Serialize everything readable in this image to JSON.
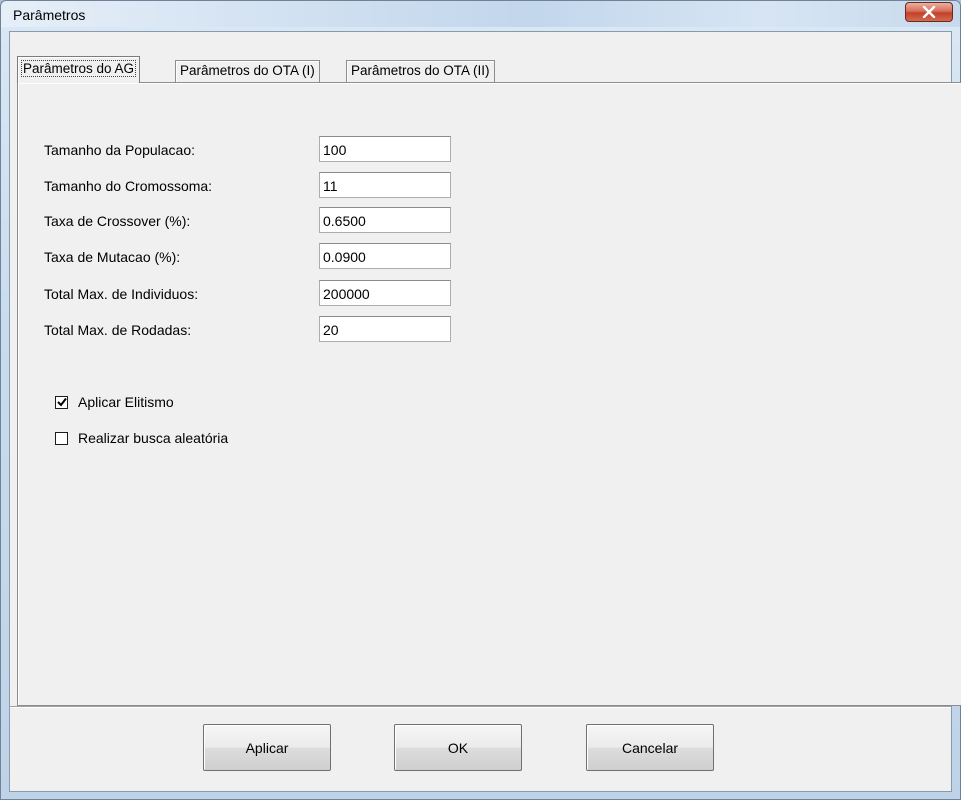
{
  "window": {
    "title": "Parâmetros",
    "close_icon": "close-icon"
  },
  "tabs": [
    {
      "label": "Parâmetros do AG",
      "active": true
    },
    {
      "label": "Parâmetros do OTA (I)",
      "active": false
    },
    {
      "label": "Parâmetros do OTA (II)",
      "active": false
    }
  ],
  "fields": [
    {
      "label": "Tamanho da Populacao:",
      "value": "100"
    },
    {
      "label": "Tamanho do Cromossoma:",
      "value": "11"
    },
    {
      "label": "Taxa de Crossover (%):",
      "value": "0.6500"
    },
    {
      "label": "Taxa de Mutacao (%):",
      "value": "0.0900"
    },
    {
      "label": "Total Max. de Individuos:",
      "value": "200000"
    },
    {
      "label": "Total Max. de Rodadas:",
      "value": "20"
    }
  ],
  "checkboxes": [
    {
      "label": "Aplicar Elitismo",
      "checked": true
    },
    {
      "label": "Realizar busca aleatória",
      "checked": false
    }
  ],
  "buttons": {
    "apply": "Aplicar",
    "ok": "OK",
    "cancel": "Cancelar"
  },
  "colors": {
    "accent_close": "#c2412a",
    "dialog_bg": "#f0f0f0"
  }
}
